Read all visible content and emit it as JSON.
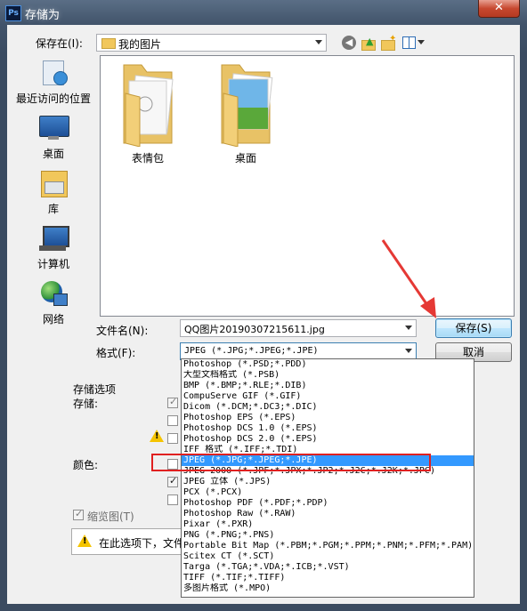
{
  "window": {
    "title": "存储为",
    "app_icon": "Ps",
    "close_label": "✕"
  },
  "location": {
    "label": "保存在(I):",
    "value": "我的图片"
  },
  "toolbar_icons": [
    "back-icon",
    "up-folder-icon",
    "new-folder-icon",
    "view-menu-icon"
  ],
  "sidebar": {
    "items": [
      {
        "label": "最近访问的位置",
        "icon": "recent-places-icon"
      },
      {
        "label": "桌面",
        "icon": "desktop-icon"
      },
      {
        "label": "库",
        "icon": "libraries-icon"
      },
      {
        "label": "计算机",
        "icon": "computer-icon"
      },
      {
        "label": "网络",
        "icon": "network-icon"
      }
    ]
  },
  "files": [
    {
      "name": "表情包",
      "icon": "folder-icon"
    },
    {
      "name": "桌面",
      "icon": "folder-icon"
    }
  ],
  "filename": {
    "label": "文件名(N):",
    "value": "QQ图片20190307215611.jpg"
  },
  "format": {
    "label": "格式(F):",
    "value": "JPEG (*.JPG;*.JPEG;*.JPE)"
  },
  "buttons": {
    "save": "保存(S)",
    "cancel": "取消"
  },
  "options": {
    "group_label": "存储选项",
    "save_label": "存储:",
    "color_label": "颜色:",
    "thumbnail_label": "缩览图(T)",
    "warning_text": "在此选项下，文件"
  },
  "format_options": [
    "Photoshop (*.PSD;*.PDD)",
    "大型文档格式 (*.PSB)",
    "BMP (*.BMP;*.RLE;*.DIB)",
    "CompuServe GIF (*.GIF)",
    "Dicom (*.DCM;*.DC3;*.DIC)",
    "Photoshop EPS (*.EPS)",
    "Photoshop DCS 1.0 (*.EPS)",
    "Photoshop DCS 2.0 (*.EPS)",
    "IFF 格式 (*.IFF;*.TDI)",
    "JPEG (*.JPG;*.JPEG;*.JPE)",
    "JPEG 2000 (*.JPF;*.JPX;*.JP2;*.J2C;*.J2K;*.JPC)",
    "JPEG 立体 (*.JPS)",
    "PCX (*.PCX)",
    "Photoshop PDF (*.PDF;*.PDP)",
    "Photoshop Raw (*.RAW)",
    "Pixar (*.PXR)",
    "PNG (*.PNG;*.PNS)",
    "Portable Bit Map (*.PBM;*.PGM;*.PPM;*.PNM;*.PFM;*.PAM)",
    "Scitex CT (*.SCT)",
    "Targa (*.TGA;*.VDA;*.ICB;*.VST)",
    "TIFF (*.TIF;*.TIFF)",
    "多图片格式 (*.MPO)"
  ],
  "selected_format_index": 9,
  "colors": {
    "selection": "#3399ff",
    "highlight_box": "#e02020",
    "annotation_arrow": "#e53935"
  }
}
